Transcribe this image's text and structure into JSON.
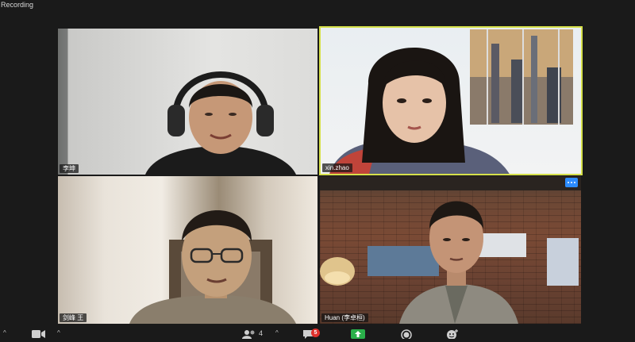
{
  "window": {
    "recording_label": "Recording"
  },
  "participants": [
    {
      "name": "李坤",
      "speaking": false
    },
    {
      "name": "xin.zhao",
      "speaking": true
    },
    {
      "name": "剑峰 王",
      "speaking": false
    },
    {
      "name": "Huan (李卓桓)",
      "speaking": false
    }
  ],
  "toolbar": {
    "participants_count": "4",
    "chat_unread": "5"
  },
  "colors": {
    "background": "#1a1a1a",
    "active_speaker_border": "#d6e04a",
    "more_button": "#2d8cff",
    "share_green": "#2ab04a",
    "badge_red": "#e0312c"
  }
}
